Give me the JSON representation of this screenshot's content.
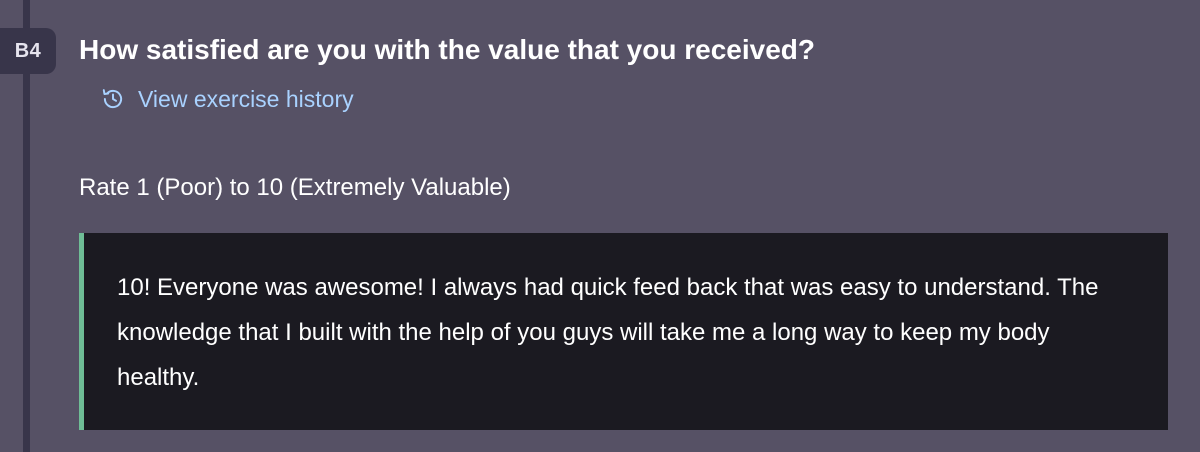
{
  "step": {
    "badge": "B4",
    "question": "How satisfied are you with the value that you received?",
    "history_link": {
      "label": "View exercise history",
      "icon": "history-icon"
    },
    "rating_prompt": "Rate 1 (Poor) to 10 (Extremely Valuable)",
    "answer": "10! Everyone was awesome! I always had quick feed back that was easy to understand. The knowledge that I built with the help of you guys will take me a long way to keep my body healthy."
  },
  "colors": {
    "background": "#565165",
    "rail": "#38354a",
    "answer_background": "#1b1a21",
    "answer_accent": "#6fbd96",
    "link": "#a9d2ff"
  }
}
